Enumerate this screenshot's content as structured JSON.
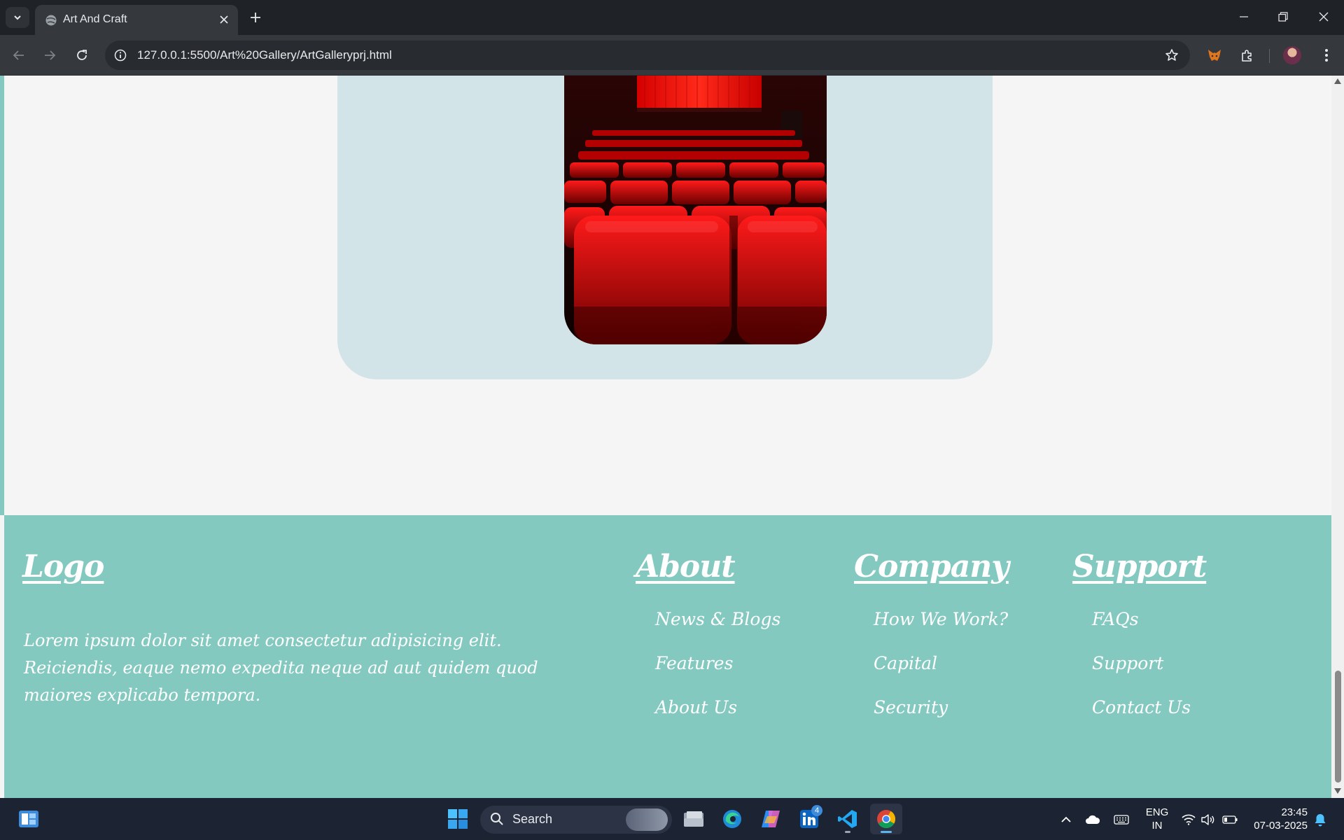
{
  "browser": {
    "tab_title": "Art And Craft",
    "url": "127.0.0.1:5500/Art%20Gallery/ArtGalleryprj.html"
  },
  "footer": {
    "logo": "Logo",
    "description": "Lorem ipsum dolor sit amet consectetur adipisicing elit. Reiciendis, eaque nemo expedita neque ad aut quidem quod maiores explicabo tempora.",
    "columns": [
      {
        "heading": "About",
        "links": [
          "News & Blogs",
          "Features",
          "About Us"
        ]
      },
      {
        "heading": "Company",
        "links": [
          "How We Work?",
          "Capital",
          "Security"
        ]
      },
      {
        "heading": "Support",
        "links": [
          "FAQs",
          "Support",
          "Contact Us"
        ]
      }
    ]
  },
  "taskbar": {
    "search_label": "Search",
    "linkedin_badge": "4",
    "language": "ENG",
    "region": "IN",
    "time": "23:45",
    "date": "07-03-2025"
  },
  "colors": {
    "footer_bg": "#84c9c0",
    "card_bg": "#d2e4e8",
    "page_bg": "#f5f5f5"
  }
}
